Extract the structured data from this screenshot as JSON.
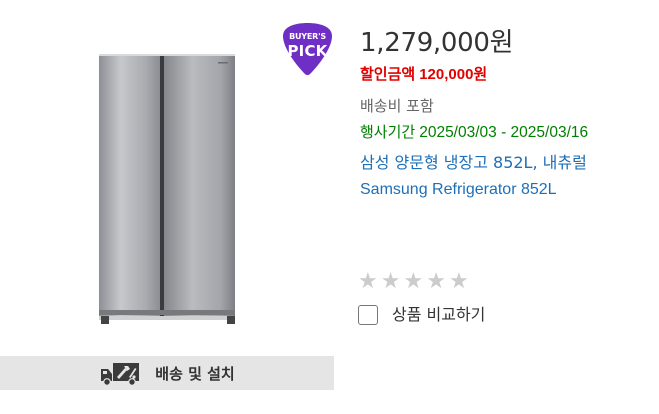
{
  "badge": {
    "line1": "BUYER'S",
    "line2": "PICK",
    "color": "#6f2fc5"
  },
  "product": {
    "price": "1,279,000원",
    "discount_label": "할인금액",
    "discount_amount": "120,000원",
    "shipping": "배송비 포함",
    "period_label": "행사기간",
    "period_dates": "2025/03/03 - 2025/03/16",
    "title_ko": "삼성 양문형 냉장고 852L, 내츄럴",
    "title_en": "Samsung Refrigerator 852L"
  },
  "rating": {
    "stars_total": 5,
    "stars_filled": 0
  },
  "compare": {
    "label": "상품 비교하기",
    "checked": false
  },
  "delivery": {
    "label": "배송 및 설치"
  },
  "colors": {
    "price": "#333333",
    "discount": "#e30000",
    "period": "#008000",
    "link": "#1d6fb8",
    "bar": "#e5e5e5"
  }
}
